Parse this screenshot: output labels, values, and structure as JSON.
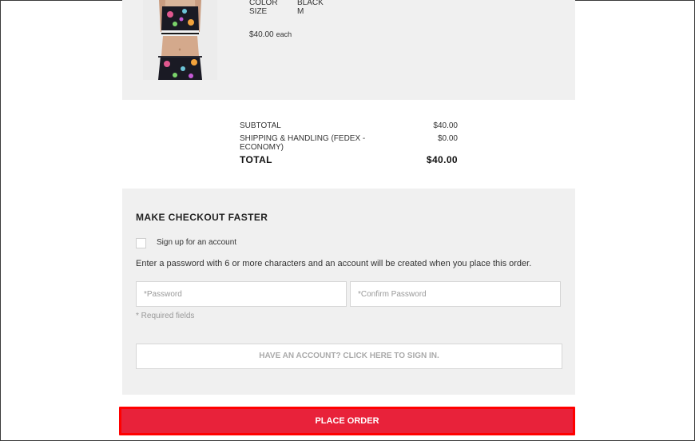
{
  "product": {
    "image_icon": "product-photo-model-floral-top-leggings",
    "attributes": [
      {
        "label": "COLOR",
        "value": "BLACK"
      },
      {
        "label": "SIZE",
        "value": "M"
      }
    ],
    "price": "$40.00",
    "price_unit": "each"
  },
  "totals": {
    "subtotal_label": "SUBTOTAL",
    "subtotal_value": "$40.00",
    "shipping_label": "SHIPPING & HANDLING (FEDEX - ECONOMY)",
    "shipping_value": "$0.00",
    "total_label": "TOTAL",
    "total_value": "$40.00"
  },
  "checkout": {
    "title": "MAKE CHECKOUT FASTER",
    "signup_label": "Sign up for an account",
    "password_hint": "Enter a password with 6 or more characters and an account will be created when you place this order.",
    "password_placeholder": "*Password",
    "confirm_placeholder": "*Confirm Password",
    "required_note": "* Required fields",
    "signin_label": "HAVE AN ACCOUNT? CLICK HERE TO SIGN IN."
  },
  "place_order_label": "PLACE ORDER",
  "colors": {
    "accent": "#e8223a",
    "highlight_border": "#ff0000",
    "panel": "#f0f0f0"
  }
}
